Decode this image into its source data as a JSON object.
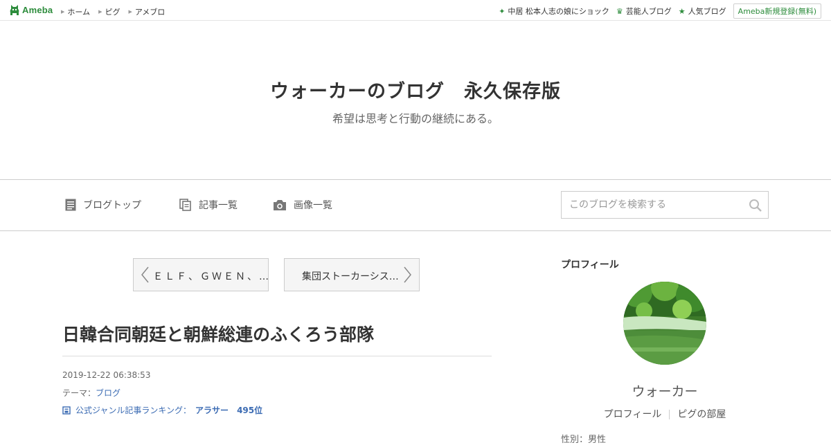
{
  "topbar": {
    "logo_text": "Ameba",
    "nav": [
      "ホーム",
      "ピグ",
      "アメブロ"
    ],
    "right_links": [
      {
        "label": "中居 松本人志の娘にショック",
        "icon": "sparkle-icon"
      },
      {
        "label": "芸能人ブログ",
        "icon": "crown-icon"
      },
      {
        "label": "人気ブログ",
        "icon": "star-icon"
      }
    ],
    "signup_label": "Ameba新規登録(無料)"
  },
  "header": {
    "title": "ウォーカーのブログ　永久保存版",
    "subtitle": "希望は思考と行動の継続にある。"
  },
  "nav": {
    "items": [
      {
        "label": "ブログトップ",
        "icon": "blog-top-icon"
      },
      {
        "label": "記事一覧",
        "icon": "article-list-icon"
      },
      {
        "label": "画像一覧",
        "icon": "camera-icon"
      }
    ],
    "search_placeholder": "このブログを検索する"
  },
  "pager": {
    "prev_label": "ＥＬＦ、ＧＷＥＮ、…",
    "next_label": "集団ストーカーシス…"
  },
  "article": {
    "title": "日韓合同朝廷と朝鮮総連のふくろう部隊",
    "date": "2019-12-22 06:38:53",
    "theme_prefix": "テーマ：",
    "theme": "ブログ",
    "ranking_label": "公式ジャンル記事ランキング：",
    "ranking_genre": "アラサー",
    "ranking_position": "495位"
  },
  "sidebar": {
    "heading": "プロフィール",
    "profile_name": "ウォーカー",
    "profile_link": "プロフィール",
    "room_link": "ピグの部屋",
    "cut_text": "性別：男性"
  },
  "colors": {
    "brand_green": "#2d8c3c",
    "link_blue": "#3b6bb3"
  }
}
